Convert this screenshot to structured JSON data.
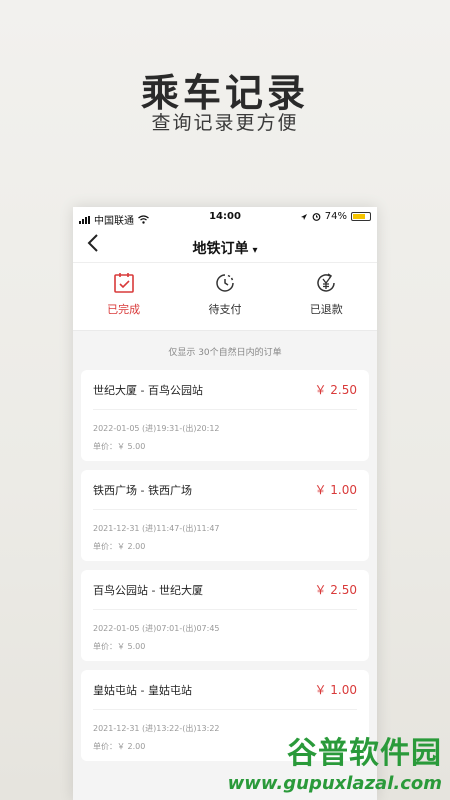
{
  "hero": {
    "title": "乘车记录",
    "subtitle": "查询记录更方便"
  },
  "status_bar": {
    "carrier": "中国联通",
    "time": "14:00",
    "battery": "74%"
  },
  "nav": {
    "back_icon": "chevron-left-icon",
    "title": "地铁订单",
    "caret": "▾"
  },
  "tabs": [
    {
      "label": "已完成",
      "icon": "calendar-check-icon",
      "active": true
    },
    {
      "label": "待支付",
      "icon": "clock-icon",
      "active": false
    },
    {
      "label": "已退款",
      "icon": "refund-yuan-icon",
      "active": false
    }
  ],
  "hint": "仅显示 30个自然日内的订单",
  "orders": [
    {
      "route": "世纪大厦 - 百鸟公园站",
      "price": "￥ 2.50",
      "time": "2022-01-05 (进)19:31-(出)20:12",
      "unit": "单价：￥ 5.00"
    },
    {
      "route": "铁西广场 - 铁西广场",
      "price": "￥ 1.00",
      "time": "2021-12-31 (进)11:47-(出)11:47",
      "unit": "单价：￥ 2.00"
    },
    {
      "route": "百鸟公园站 - 世纪大厦",
      "price": "￥ 2.50",
      "time": "2022-01-05 (进)07:01-(出)07:45",
      "unit": "单价：￥ 5.00"
    },
    {
      "route": "皇姑屯站 - 皇姑屯站",
      "price": "￥ 1.00",
      "time": "2021-12-31 (进)13:22-(出)13:22",
      "unit": "单价：￥ 2.00"
    }
  ],
  "watermark": {
    "brand": "谷普软件园",
    "url": "www.gupuxlazal.com"
  },
  "colors": {
    "accent": "#d93a3a",
    "watermark": "#2a9a3a"
  }
}
